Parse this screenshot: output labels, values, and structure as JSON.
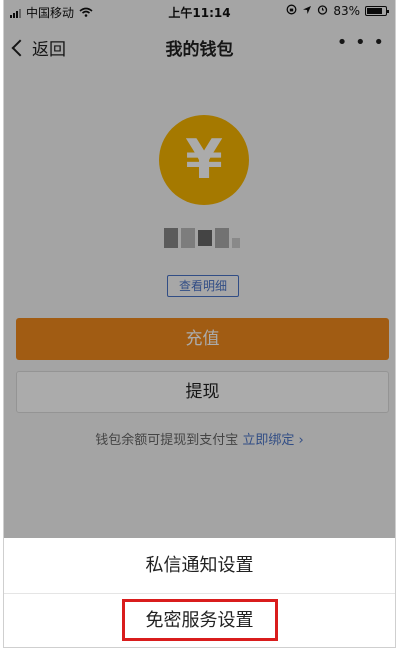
{
  "status_bar": {
    "carrier": "中国移动",
    "time": "上午11:14",
    "battery": "83%"
  },
  "navbar": {
    "back_label": "返回",
    "title": "我的钱包",
    "more": "• • •"
  },
  "wallet": {
    "currency_symbol": "¥",
    "detail_label": "查看明细",
    "recharge_label": "充值",
    "withdraw_label": "提现",
    "note_text": "钱包余额可提现到支付宝",
    "note_link": "立即绑定 ›"
  },
  "action_sheet": {
    "items": [
      {
        "label": "私信通知设置"
      },
      {
        "label": "免密服务设置"
      }
    ]
  },
  "colors": {
    "coin": "#f7b500",
    "recharge": "#f08a1d",
    "link": "#4a74c7",
    "highlight": "#d91c1c"
  }
}
